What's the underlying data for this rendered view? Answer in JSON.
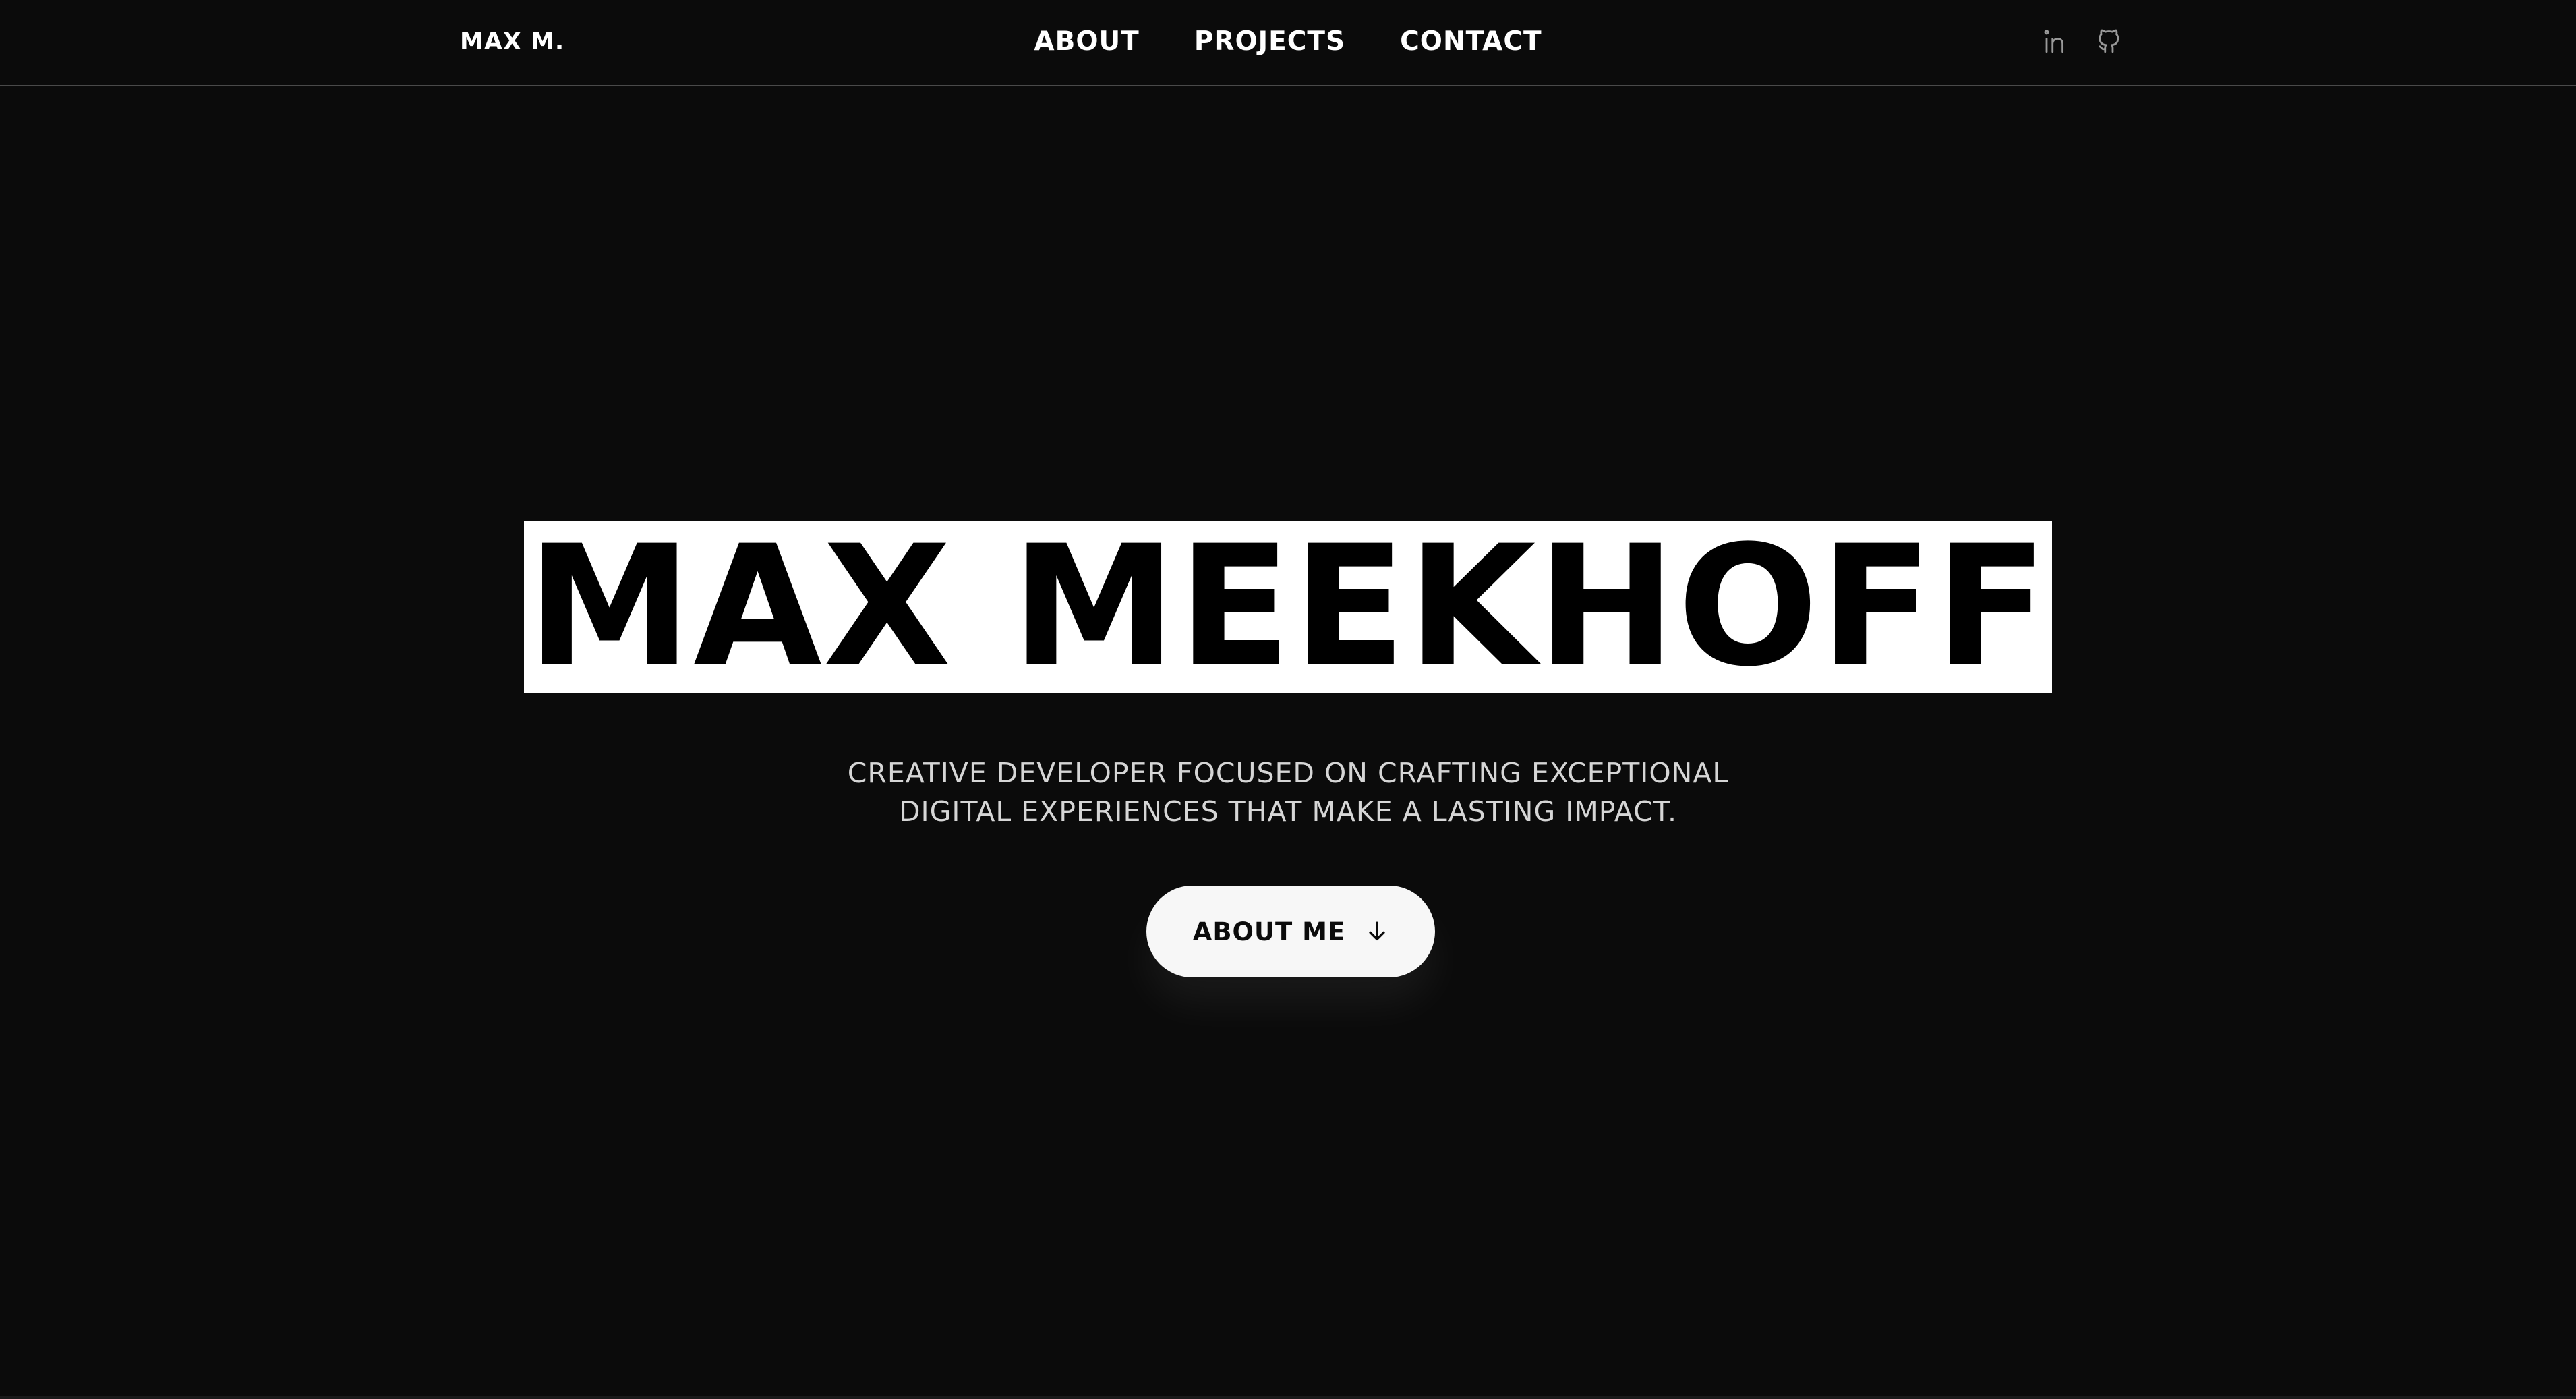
{
  "header": {
    "brand": "MAX M.",
    "nav": [
      {
        "label": "ABOUT"
      },
      {
        "label": "PROJECTS"
      },
      {
        "label": "CONTACT"
      }
    ],
    "socials": [
      {
        "icon": "linkedin-icon"
      },
      {
        "icon": "github-icon"
      }
    ]
  },
  "hero": {
    "title": "MAX MEEKHOFF",
    "tagline_line1": "CREATIVE DEVELOPER FOCUSED ON CRAFTING EXCEPTIONAL",
    "tagline_line2": "DIGITAL EXPERIENCES THAT MAKE A LASTING IMPACT.",
    "cta_label": "ABOUT ME",
    "cta_icon": "arrow-down-icon"
  },
  "colors": {
    "background": "#0b0b0b",
    "text": "#ffffff",
    "title_highlight": "#ffffff",
    "button_bg": "#f7f7f7"
  }
}
